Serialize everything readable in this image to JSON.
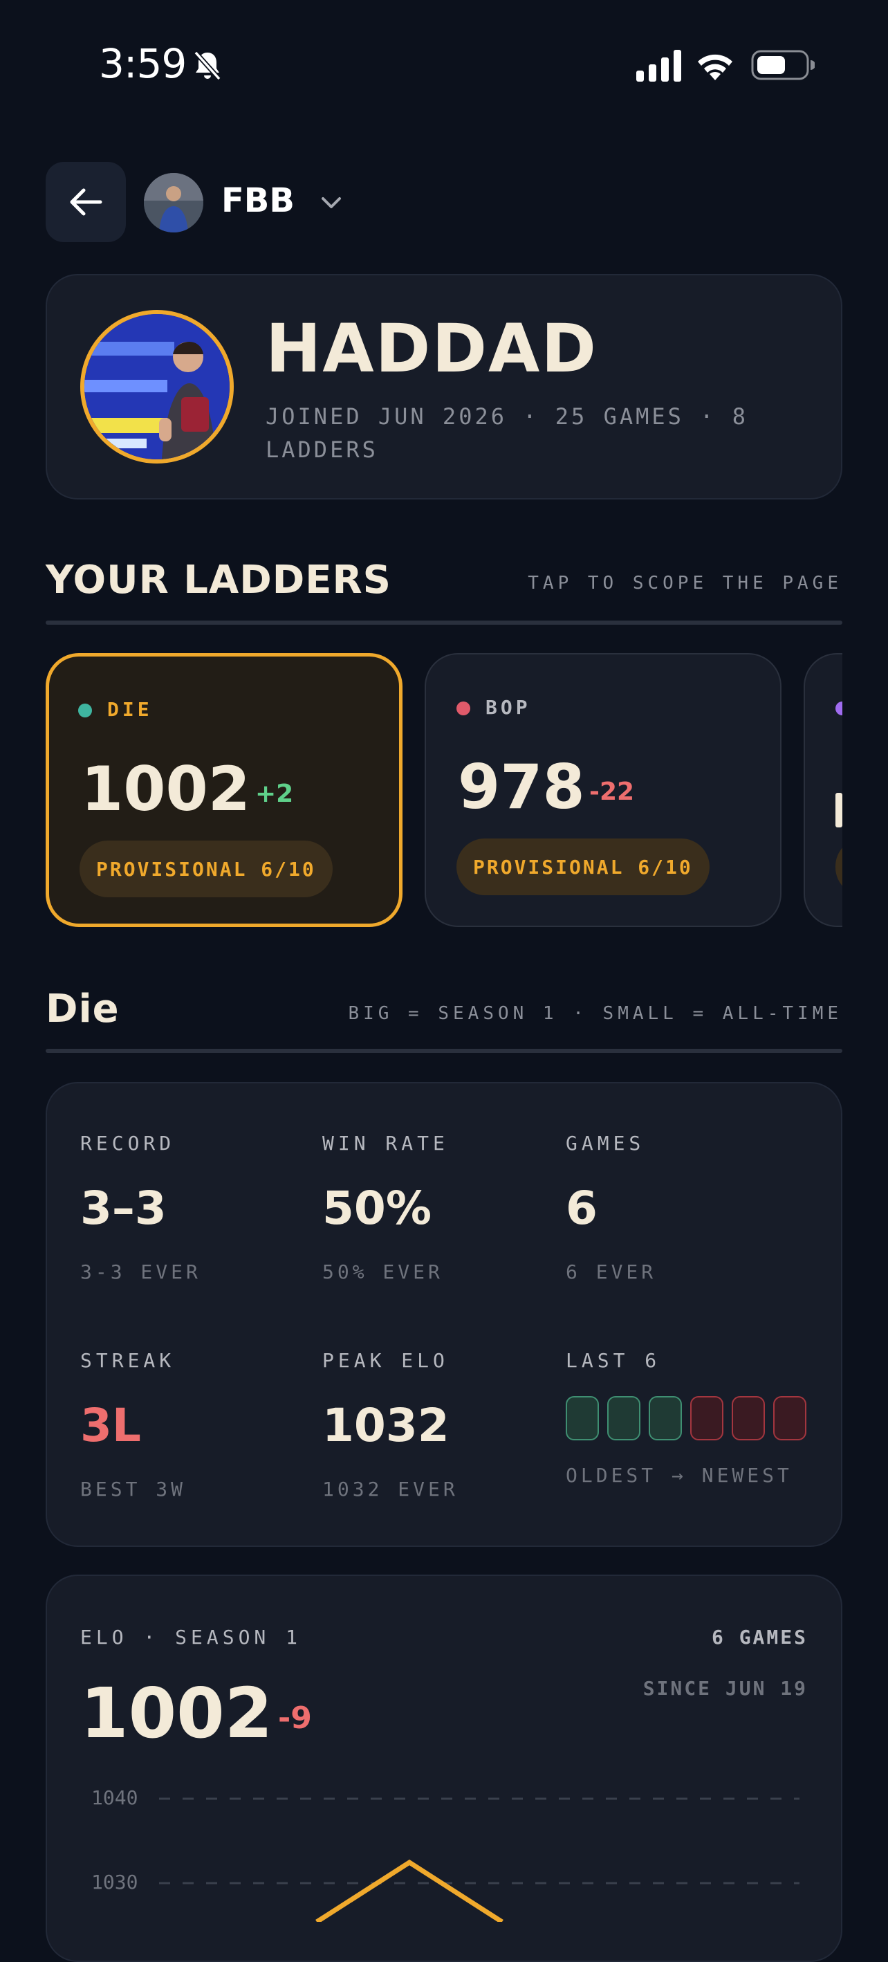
{
  "status_bar": {
    "time": "3:59"
  },
  "header": {
    "group_name": "FBB"
  },
  "profile": {
    "name": "HADDAD",
    "meta": "JOINED JUN 2026 · 25 GAMES · 8 LADDERS"
  },
  "ladders_section": {
    "title": "YOUR LADDERS",
    "hint": "TAP TO SCOPE THE PAGE",
    "items": [
      {
        "label": "DIE",
        "elo": "1002",
        "delta": "+2",
        "status": "PROVISIONAL 6/10",
        "dot_color": "#3fb5a0",
        "delta_color": "#5fd08a"
      },
      {
        "label": "BOP",
        "elo": "978",
        "delta": "-22",
        "status": "PROVISIONAL 6/10",
        "dot_color": "#e05a6a",
        "delta_color": "#ee6e6e"
      },
      {
        "dot_color": "#a06cf0"
      }
    ]
  },
  "scope_section": {
    "title": "Die",
    "hint": "BIG = SEASON 1 · SMALL = ALL-TIME"
  },
  "stats": {
    "record": {
      "label": "RECORD",
      "value": "3–3",
      "sub": "3-3 EVER"
    },
    "win_rate": {
      "label": "WIN RATE",
      "value": "50%",
      "sub": "50% EVER"
    },
    "games": {
      "label": "GAMES",
      "value": "6",
      "sub": "6 EVER"
    },
    "streak": {
      "label": "STREAK",
      "value": "3L",
      "sub": "BEST 3W"
    },
    "peak_elo": {
      "label": "PEAK ELO",
      "value": "1032",
      "sub": "1032 EVER"
    },
    "last": {
      "label": "LAST 6",
      "results": [
        "W",
        "W",
        "W",
        "L",
        "L",
        "L"
      ],
      "sub": "OLDEST → NEWEST"
    }
  },
  "elo_card": {
    "label": "ELO · SEASON 1",
    "games": "6 GAMES",
    "since": "SINCE JUN 19",
    "value": "1002",
    "delta": "-9",
    "y_ticks": [
      "1040",
      "1030"
    ]
  },
  "colors": {
    "accent": "#f0a92c",
    "win": "#3f8f72",
    "loss": "#a3363f",
    "streak_loss": "#ee6e6e"
  }
}
